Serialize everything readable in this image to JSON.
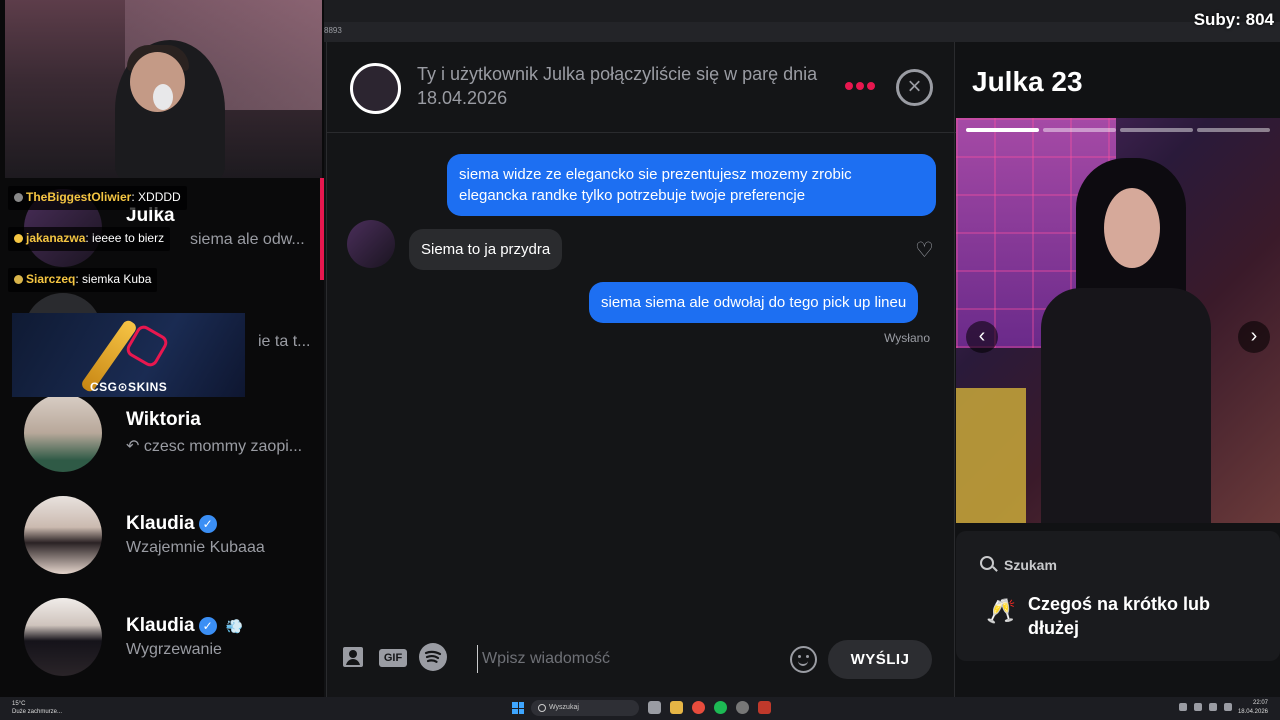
{
  "stream": {
    "sub_counter": "Suby: 804",
    "chat": [
      {
        "user": "TheBiggestOliwier",
        "text": ": XDDDD"
      },
      {
        "user": "jakanazwa",
        "text": ": ieeee to bierz"
      },
      {
        "user": "Siarczeq",
        "text": ": siemka Kuba"
      }
    ],
    "ad_label": "CSG⊙SKINS"
  },
  "browser": {
    "url_fragment": "8893"
  },
  "sidebar": {
    "matches": [
      {
        "name": "Julka",
        "preview": "siema ale odw...",
        "selected": true
      },
      {
        "name": "",
        "preview": "ie ta t..."
      },
      {
        "name": "Wiktoria",
        "preview": "↶ czesc mommy zaopi..."
      },
      {
        "name": "Klaudia",
        "preview": "Wzajemnie Kubaaa",
        "verified": "✓"
      },
      {
        "name": "Klaudia",
        "preview": "Wygrzewanie",
        "verified": "✓",
        "extra": "💨"
      }
    ]
  },
  "conversation": {
    "header": "Ty i użytkownik Julka połączyliście się w parę dnia 18.04.2026",
    "close_glyph": "×",
    "messages": [
      {
        "from": "me",
        "text": "siema widze ze elegancko sie prezentujesz mozemy zrobic elegancka randke tylko potrzebuje twoje preferencje"
      },
      {
        "from": "her",
        "text": "Siema to ja przydra"
      },
      {
        "from": "me",
        "text": "siema siema ale odwołaj do tego pick up lineu"
      }
    ],
    "status": "Wysłano",
    "composer": {
      "gif_label": "GIF",
      "placeholder": "Wpisz wiadomość",
      "send_label": "WYŚLIJ"
    }
  },
  "profile": {
    "title": "Julka 23",
    "seeking_label": "Szukam",
    "seeking_value": "Czegoś na krótko lub dłużej",
    "arrow_left": "‹",
    "arrow_right": "›"
  },
  "taskbar": {
    "weather_temp": "15°C",
    "weather_desc": "Duże zachmurze...",
    "search_placeholder": "Wyszukaj",
    "time": "22:07",
    "date": "18.04.2026"
  },
  "colors": {
    "accent": "#e8174f",
    "bubble_out": "#1d6ff2",
    "bubble_in": "#2a2b2e",
    "verified": "#3b8ff5"
  }
}
